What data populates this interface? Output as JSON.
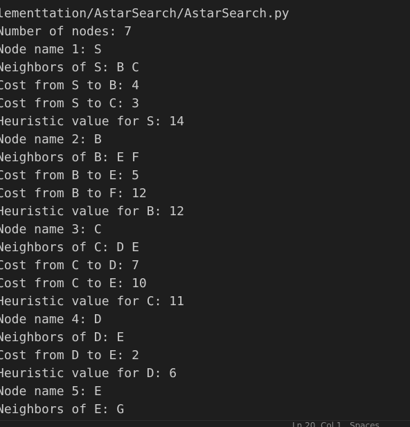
{
  "terminal": {
    "lines": [
      "lementtation/AstarSearch/AstarSearch.py",
      "Number of nodes: 7",
      "Node name 1: S",
      "Neighbors of S: B C",
      "Cost from S to B: 4",
      "Cost from S to C: 3",
      "Heuristic value for S: 14",
      "Node name 2: B",
      "Neighbors of B: E F",
      "Cost from B to E: 5",
      "Cost from B to F: 12",
      "Heuristic value for B: 12",
      "Node name 3: C",
      "Neighbors of C: D E",
      "Cost from C to D: 7",
      "Cost from C to E: 10",
      "Heuristic value for C: 11",
      "Node name 4: D",
      "Neighbors of D: E",
      "Cost from D to E: 2",
      "Heuristic value for D: 6",
      "Node name 5: E",
      "Neighbors of E: G"
    ]
  },
  "status_bar": {
    "text": "Ln 20, Col 1   Spaces"
  }
}
